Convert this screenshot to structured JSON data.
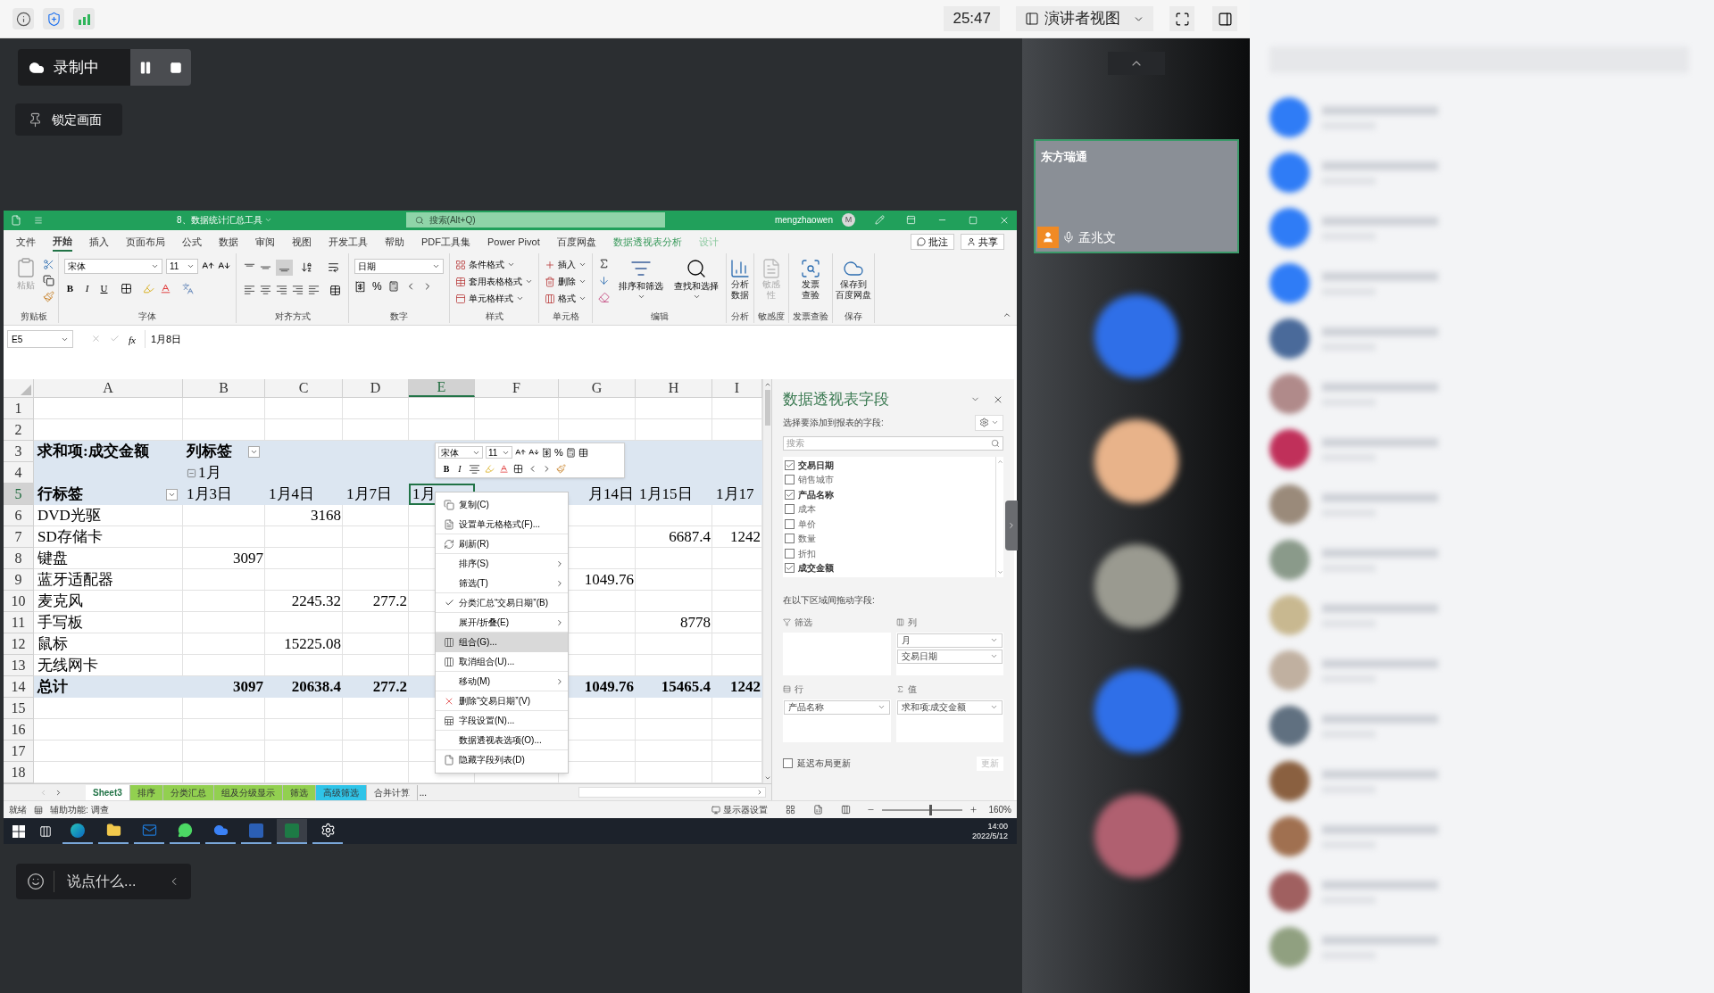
{
  "meeting": {
    "timer": "25:47",
    "view_mode": "演讲者视图",
    "recording_status": "录制中",
    "lock_button": "锁定画面",
    "chat_placeholder": "说点什么..."
  },
  "video": {
    "org": "东方瑞通",
    "speaker": "孟兆文"
  },
  "excel": {
    "file_title": "8、数据统计汇总工具",
    "search_placeholder": "搜索(Alt+Q)",
    "user": "mengzhaowen",
    "user_initial": "M",
    "menu_tabs": [
      {
        "label": "文件",
        "selected": false,
        "kind": "normal"
      },
      {
        "label": "开始",
        "selected": true,
        "kind": "normal"
      },
      {
        "label": "插入",
        "selected": false,
        "kind": "normal"
      },
      {
        "label": "页面布局",
        "selected": false,
        "kind": "normal"
      },
      {
        "label": "公式",
        "selected": false,
        "kind": "normal"
      },
      {
        "label": "数据",
        "selected": false,
        "kind": "normal"
      },
      {
        "label": "审阅",
        "selected": false,
        "kind": "normal"
      },
      {
        "label": "视图",
        "selected": false,
        "kind": "normal"
      },
      {
        "label": "开发工具",
        "selected": false,
        "kind": "normal"
      },
      {
        "label": "帮助",
        "selected": false,
        "kind": "normal"
      },
      {
        "label": "PDF工具集",
        "selected": false,
        "kind": "normal"
      },
      {
        "label": "Power Pivot",
        "selected": false,
        "kind": "normal"
      },
      {
        "label": "百度网盘",
        "selected": false,
        "kind": "normal"
      },
      {
        "label": "数据透视表分析",
        "selected": false,
        "kind": "contextual"
      },
      {
        "label": "设计",
        "selected": false,
        "kind": "contextual"
      }
    ],
    "comment_button": "批注",
    "share_button": "共享",
    "ribbon": [
      {
        "kind": "clipboard",
        "label": "剪贴板",
        "texts": [
          "粘贴"
        ]
      },
      {
        "kind": "font",
        "label": "字体",
        "font": "宋体",
        "size": "11",
        "texts": [
          "B",
          "I",
          "U"
        ]
      },
      {
        "kind": "alignment",
        "label": "对齐方式"
      },
      {
        "kind": "number",
        "label": "数字",
        "format": "日期",
        "texts": [
          "%"
        ]
      },
      {
        "kind": "styles",
        "label": "样式",
        "texts": [
          "条件格式",
          "套用表格格式",
          "单元格样式"
        ]
      },
      {
        "kind": "cells",
        "label": "单元格",
        "texts": [
          "插入",
          "删除",
          "格式"
        ]
      },
      {
        "kind": "editing",
        "label": "编辑",
        "texts": [
          "排序和筛选",
          "查找和选择"
        ]
      },
      {
        "kind": "big",
        "label": "分析",
        "lines": [
          "分析",
          "数据"
        ],
        "disabled": false
      },
      {
        "kind": "big",
        "label": "敏感度",
        "lines": [
          "敏感",
          "性"
        ],
        "disabled": true
      },
      {
        "kind": "big",
        "label": "发票查验",
        "lines": [
          "发票",
          "查验"
        ],
        "disabled": false
      },
      {
        "kind": "big",
        "label": "保存",
        "lines": [
          "保存到",
          "百度网盘"
        ],
        "disabled": false
      }
    ],
    "name_box": "E5",
    "function_label": "fx",
    "formula": "1月8日",
    "columns": [
      {
        "label": "A",
        "selected": false
      },
      {
        "label": "B",
        "selected": false
      },
      {
        "label": "C",
        "selected": false
      },
      {
        "label": "D",
        "selected": false
      },
      {
        "label": "E",
        "selected": true
      },
      {
        "label": "F",
        "selected": false
      },
      {
        "label": "G",
        "selected": false
      },
      {
        "label": "H",
        "selected": false
      },
      {
        "label": "I",
        "selected": false
      }
    ],
    "rows": [
      {
        "number": "1",
        "kind": "plain",
        "selected": false
      },
      {
        "number": "2",
        "kind": "plain",
        "selected": false
      },
      {
        "number": "3",
        "kind": "band",
        "selected": false,
        "cells": [
          {
            "kind": "label",
            "text": "求和项:成交金额"
          },
          {
            "kind": "label_filter",
            "text": "列标签"
          }
        ]
      },
      {
        "number": "4",
        "kind": "band",
        "selected": false,
        "cells": [
          {
            "kind": "empty"
          },
          {
            "kind": "group",
            "text": "1月"
          }
        ]
      },
      {
        "number": "5",
        "kind": "band",
        "selected": true,
        "cells": [
          {
            "kind": "label_filter",
            "text": "行标签"
          },
          {
            "kind": "text",
            "text": "1月3日"
          },
          {
            "kind": "text",
            "text": "1月4日"
          },
          {
            "kind": "text",
            "text": "1月7日"
          },
          {
            "kind": "text",
            "text": "1月"
          },
          {
            "kind": "empty"
          },
          {
            "kind": "number",
            "text": "月14日"
          },
          {
            "kind": "text",
            "text": "1月15日"
          },
          {
            "kind": "text",
            "text": "1月17"
          }
        ]
      },
      {
        "number": "6",
        "kind": "plain",
        "selected": false,
        "cells": [
          {
            "kind": "text",
            "text": "DVD光驱"
          },
          {
            "kind": "empty"
          },
          {
            "kind": "number",
            "text": "3168"
          }
        ]
      },
      {
        "number": "7",
        "kind": "plain",
        "selected": false,
        "cells": [
          {
            "kind": "text",
            "text": "SD存储卡"
          },
          {
            "kind": "empty"
          },
          {
            "kind": "empty"
          },
          {
            "kind": "empty"
          },
          {
            "kind": "empty"
          },
          {
            "kind": "empty"
          },
          {
            "kind": "empty"
          },
          {
            "kind": "number",
            "text": "6687.4"
          },
          {
            "kind": "number",
            "text": "1242"
          }
        ]
      },
      {
        "number": "8",
        "kind": "plain",
        "selected": false,
        "cells": [
          {
            "kind": "text",
            "text": "键盘"
          },
          {
            "kind": "number",
            "text": "3097"
          }
        ]
      },
      {
        "number": "9",
        "kind": "plain",
        "selected": false,
        "cells": [
          {
            "kind": "text",
            "text": "蓝牙适配器"
          },
          {
            "kind": "empty"
          },
          {
            "kind": "empty"
          },
          {
            "kind": "empty"
          },
          {
            "kind": "empty"
          },
          {
            "kind": "empty"
          },
          {
            "kind": "number",
            "text": "1049.76"
          }
        ]
      },
      {
        "number": "10",
        "kind": "plain",
        "selected": false,
        "cells": [
          {
            "kind": "text",
            "text": "麦克风"
          },
          {
            "kind": "empty"
          },
          {
            "kind": "number",
            "text": "2245.32"
          },
          {
            "kind": "number",
            "text": "277.2"
          }
        ]
      },
      {
        "number": "11",
        "kind": "plain",
        "selected": false,
        "cells": [
          {
            "kind": "text",
            "text": "手写板"
          },
          {
            "kind": "empty"
          },
          {
            "kind": "empty"
          },
          {
            "kind": "empty"
          },
          {
            "kind": "empty"
          },
          {
            "kind": "empty"
          },
          {
            "kind": "empty"
          },
          {
            "kind": "number",
            "text": "8778"
          }
        ]
      },
      {
        "number": "12",
        "kind": "plain",
        "selected": false,
        "cells": [
          {
            "kind": "text",
            "text": "鼠标"
          },
          {
            "kind": "empty"
          },
          {
            "kind": "number",
            "text": "15225.08"
          }
        ]
      },
      {
        "number": "13",
        "kind": "plain",
        "selected": false,
        "cells": [
          {
            "kind": "text",
            "text": "无线网卡"
          }
        ]
      },
      {
        "number": "14",
        "kind": "total",
        "selected": false,
        "cells": [
          {
            "kind": "text",
            "text": "总计"
          },
          {
            "kind": "number",
            "text": "3097"
          },
          {
            "kind": "number",
            "text": "20638.4"
          },
          {
            "kind": "number",
            "text": "277.2"
          },
          {
            "kind": "empty"
          },
          {
            "kind": "empty"
          },
          {
            "kind": "number",
            "text": "1049.76"
          },
          {
            "kind": "number",
            "text": "15465.4"
          },
          {
            "kind": "number",
            "text": "1242"
          }
        ]
      },
      {
        "number": "15",
        "kind": "plain",
        "selected": false
      },
      {
        "number": "16",
        "kind": "plain",
        "selected": false
      },
      {
        "number": "17",
        "kind": "plain",
        "selected": false
      },
      {
        "number": "18",
        "kind": "plain",
        "selected": false
      }
    ],
    "mini_toolbar": {
      "font": "宋体",
      "size": "11",
      "texts": [
        "%",
        "B",
        "I"
      ]
    },
    "context_menu": [
      {
        "label": "复制(C)",
        "kind": "icon",
        "selected": false,
        "checked": false,
        "divider_after": false
      },
      {
        "label": "设置单元格格式(F)...",
        "kind": "icon",
        "selected": false,
        "checked": false,
        "divider_after": true
      },
      {
        "label": "刷新(R)",
        "kind": "icon",
        "selected": false,
        "checked": false,
        "divider_after": true
      },
      {
        "label": "排序(S)",
        "kind": "submenu",
        "selected": false,
        "checked": false,
        "divider_after": false
      },
      {
        "label": "筛选(T)",
        "kind": "submenu",
        "selected": false,
        "checked": false,
        "divider_after": true
      },
      {
        "label": "分类汇总“交易日期”(B)",
        "kind": "plain",
        "selected": false,
        "checked": true,
        "divider_after": true
      },
      {
        "label": "展开/折叠(E)",
        "kind": "submenu",
        "selected": false,
        "checked": false,
        "divider_after": true
      },
      {
        "label": "组合(G)...",
        "kind": "icon",
        "selected": true,
        "checked": false,
        "divider_after": false
      },
      {
        "label": "取消组合(U)...",
        "kind": "icon",
        "selected": false,
        "checked": false,
        "divider_after": true
      },
      {
        "label": "移动(M)",
        "kind": "submenu",
        "selected": false,
        "checked": false,
        "divider_after": true
      },
      {
        "label": "删除“交易日期”(V)",
        "kind": "icon",
        "selected": false,
        "checked": false,
        "divider_after": true
      },
      {
        "label": "字段设置(N)...",
        "kind": "icon",
        "selected": false,
        "checked": false,
        "divider_after": true
      },
      {
        "label": "数据透视表选项(O)...",
        "kind": "plain",
        "selected": false,
        "checked": false,
        "divider_after": true
      },
      {
        "label": "隐藏字段列表(D)",
        "kind": "icon",
        "selected": false,
        "checked": false,
        "divider_after": false
      }
    ],
    "pivot_pane": {
      "title": "数据透视表字段",
      "subtitle": "选择要添加到报表的字段:",
      "search_placeholder": "搜索",
      "fields": [
        {
          "label": "交易日期",
          "checked": true
        },
        {
          "label": "销售城市",
          "checked": false
        },
        {
          "label": "产品名称",
          "checked": true
        },
        {
          "label": "成本",
          "checked": false
        },
        {
          "label": "单价",
          "checked": false
        },
        {
          "label": "数量",
          "checked": false
        },
        {
          "label": "折扣",
          "checked": false
        },
        {
          "label": "成交金额",
          "checked": true
        }
      ],
      "areas_hint": "在以下区域间拖动字段:",
      "areas": [
        {
          "kind": "filter",
          "label": "筛选"
        },
        {
          "kind": "columns",
          "label": "列",
          "fields": [
            "月",
            "交易日期"
          ]
        },
        {
          "kind": "rows",
          "label": "行",
          "fields": [
            "产品名称"
          ]
        },
        {
          "kind": "values",
          "label": "值",
          "fields": [
            "求和项:成交金额"
          ]
        }
      ],
      "defer_update": {
        "label": "延迟布局更新",
        "checked": false
      },
      "update_button": "更新"
    },
    "sheet_tabs": [
      {
        "label": "Sheet3",
        "selected": true
      },
      {
        "label": "排序",
        "selected": false,
        "color": "#92d050"
      },
      {
        "label": "分类汇总",
        "selected": false,
        "color": "#92d050"
      },
      {
        "label": "组及分级显示",
        "selected": false,
        "color": "#92d050"
      },
      {
        "label": "筛选",
        "selected": false,
        "color": "#92d050"
      },
      {
        "label": "高级筛选",
        "selected": false,
        "color": "#2fc4e8"
      },
      {
        "label": "合并计算",
        "selected": false
      }
    ],
    "more_tabs": "...",
    "status": {
      "ready": "就绪",
      "accessibility": "辅助功能: 调查",
      "display_settings": "显示器设置",
      "zoom": "160%",
      "zoom_slider": {
        "level": 0.6
      }
    },
    "taskbar": {
      "time": "14:00",
      "date": "2022/5/12",
      "apps": [
        {
          "kind": "edge",
          "selected": false
        },
        {
          "kind": "folder",
          "selected": false
        },
        {
          "kind": "outlook",
          "selected": false
        },
        {
          "kind": "wechat",
          "selected": false
        },
        {
          "kind": "cloud",
          "selected": false
        },
        {
          "kind": "word",
          "selected": false
        },
        {
          "kind": "excel",
          "selected": true
        },
        {
          "kind": "settings",
          "selected": false
        }
      ]
    }
  }
}
